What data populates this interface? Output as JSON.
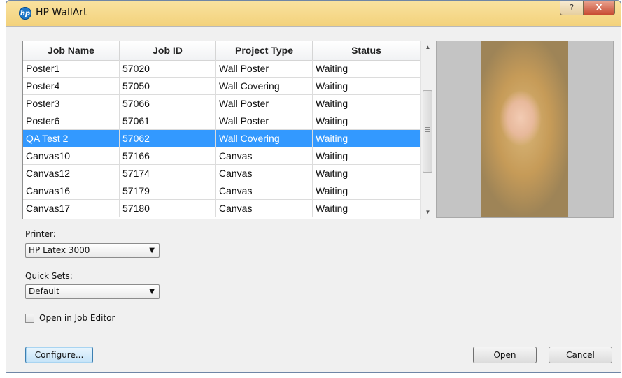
{
  "window": {
    "title": "HP WallArt",
    "app_icon_text": "hp",
    "help_label": "?",
    "close_label": "X"
  },
  "table": {
    "columns": [
      "Job Name",
      "Job ID",
      "Project Type",
      "Status"
    ],
    "rows": [
      [
        "Poster1",
        "57020",
        "Wall Poster",
        "Waiting"
      ],
      [
        "Poster4",
        "57050",
        "Wall Covering",
        "Waiting"
      ],
      [
        "Poster3",
        "57066",
        "Wall Poster",
        "Waiting"
      ],
      [
        "Poster6",
        "57061",
        "Wall Poster",
        "Waiting"
      ],
      [
        "QA Test 2",
        "57062",
        "Wall Covering",
        "Waiting"
      ],
      [
        "Canvas10",
        "57166",
        "Canvas",
        "Waiting"
      ],
      [
        "Canvas12",
        "57174",
        "Canvas",
        "Waiting"
      ],
      [
        "Canvas16",
        "57179",
        "Canvas",
        "Waiting"
      ],
      [
        "Canvas17",
        "57180",
        "Canvas",
        "Waiting"
      ]
    ],
    "selected_row": 4,
    "scroll_up": "▲",
    "scroll_down": "▼"
  },
  "printer": {
    "label": "Printer:",
    "value": "HP Latex 3000"
  },
  "quick_sets": {
    "label": "Quick Sets:",
    "value": "Default"
  },
  "open_in_editor": {
    "label": "Open in Job Editor",
    "checked": false
  },
  "buttons": {
    "configure": "Configure...",
    "open": "Open",
    "cancel": "Cancel"
  },
  "dropdown_arrow": "▼",
  "colors": {
    "selection": "#3399ff",
    "title_bar": "#f3d27c"
  }
}
